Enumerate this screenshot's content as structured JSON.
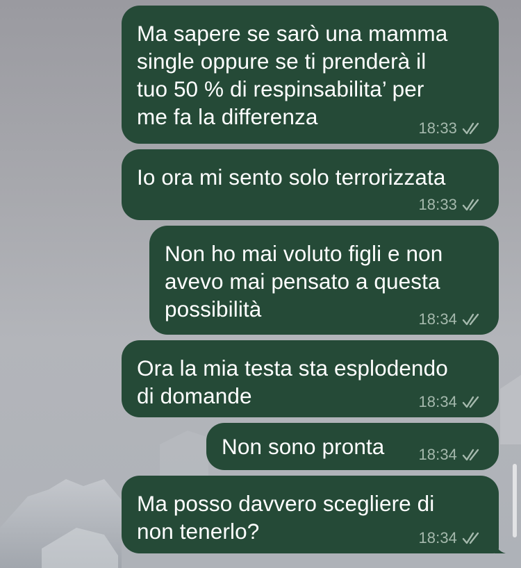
{
  "colors": {
    "bubble_bg": "#254a37",
    "bubble_text": "#ffffff",
    "meta_text": "#a5b9ad"
  },
  "messages": [
    {
      "text": "Ma sapere se sarò una mamma\nsingle oppure se ti prenderà il\ntuo 50 % di respinsabilita’ per\nme fa la differenza",
      "time": "18:33",
      "status_icon": "double-check-icon"
    },
    {
      "text": "Io ora mi sento solo terrorizzata",
      "time": "18:33",
      "status_icon": "double-check-icon"
    },
    {
      "text": "Non ho mai voluto figli e non\navevo mai pensato a questa\npossibilità",
      "time": "18:34",
      "status_icon": "double-check-icon"
    },
    {
      "text": "Ora la mia testa sta esplodendo\ndi domande",
      "time": "18:34",
      "status_icon": "double-check-icon"
    },
    {
      "text": "Non sono pronta",
      "time": "18:34",
      "status_icon": "double-check-icon"
    },
    {
      "text": "Ma posso davvero scegliere di\nnon tenerlo?",
      "time": "18:34",
      "status_icon": "double-check-icon"
    }
  ]
}
